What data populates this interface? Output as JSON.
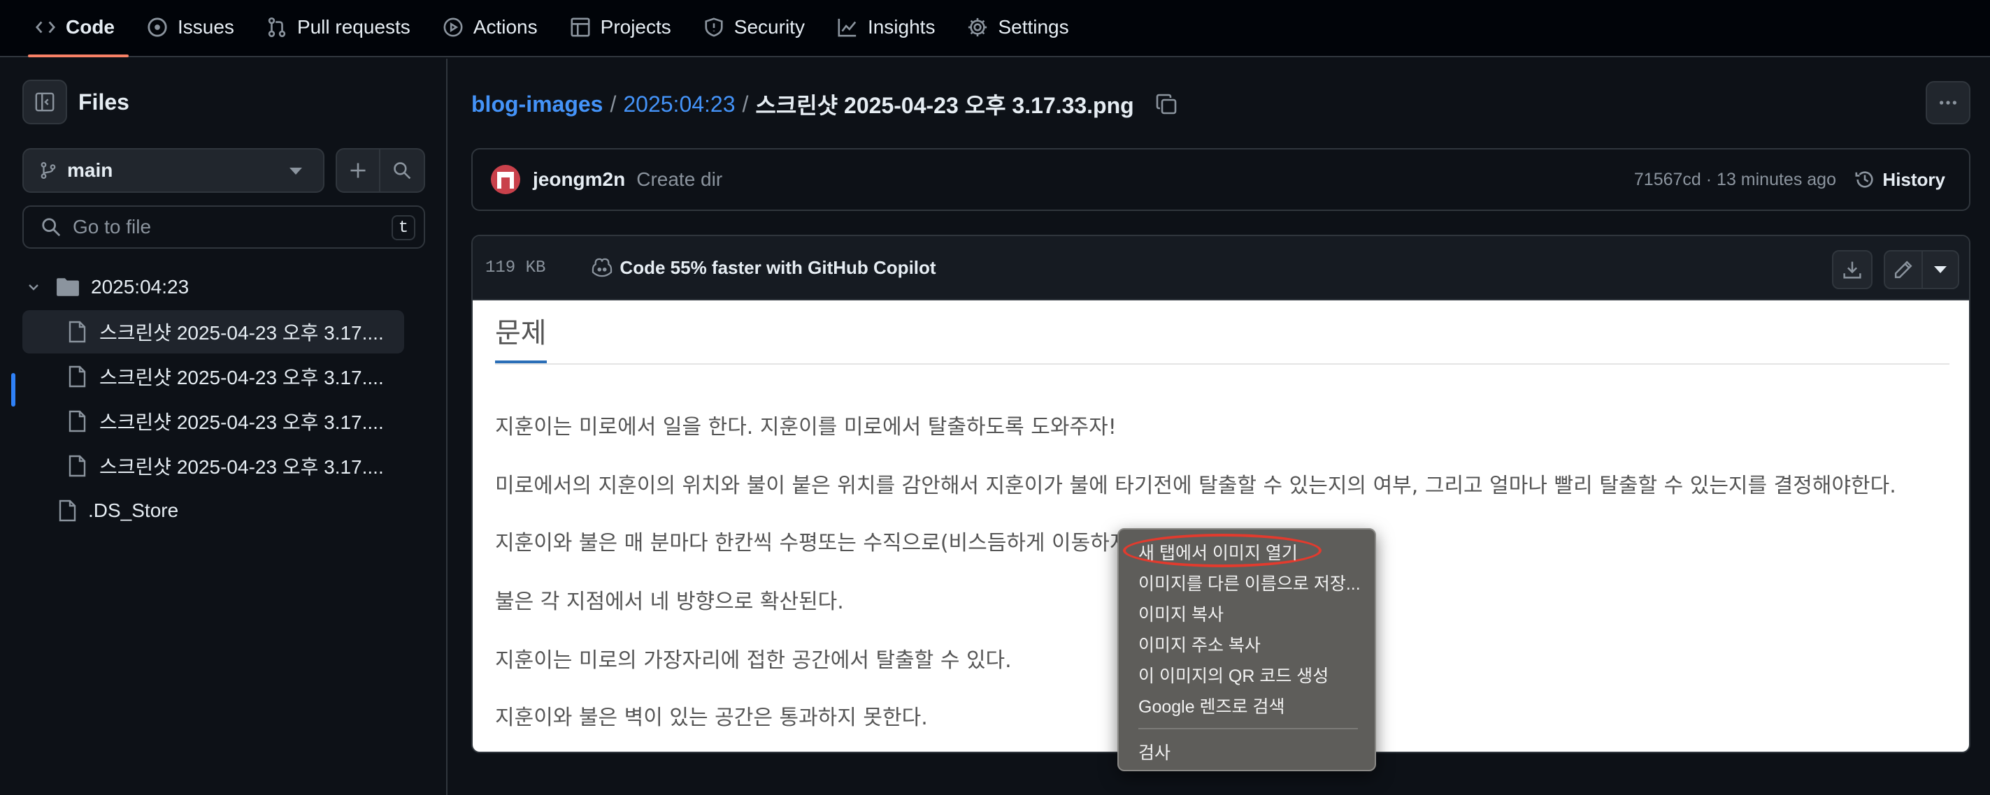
{
  "topnav": {
    "tabs": [
      {
        "label": "Code",
        "icon": "code-icon"
      },
      {
        "label": "Issues",
        "icon": "issue-icon"
      },
      {
        "label": "Pull requests",
        "icon": "pull-request-icon"
      },
      {
        "label": "Actions",
        "icon": "play-icon"
      },
      {
        "label": "Projects",
        "icon": "table-icon"
      },
      {
        "label": "Security",
        "icon": "shield-icon"
      },
      {
        "label": "Insights",
        "icon": "graph-icon"
      },
      {
        "label": "Settings",
        "icon": "gear-icon"
      }
    ],
    "active": "Code",
    "accent": "#f78166"
  },
  "sidebar": {
    "title": "Files",
    "branch": "main",
    "goto_placeholder": "Go to file",
    "goto_shortcut": "t",
    "tree": {
      "folder": "2025:04:23",
      "files": [
        "스크린샷 2025-04-23 오후 3.17....",
        "스크린샷 2025-04-23 오후 3.17....",
        "스크린샷 2025-04-23 오후 3.17....",
        "스크린샷 2025-04-23 오후 3.17...."
      ],
      "root_file": ".DS_Store"
    }
  },
  "breadcrumb": {
    "repo": "blog-images",
    "folder": "2025:04:23",
    "file": "스크린샷 2025-04-23 오후 3.17.33.png",
    "sep": "/"
  },
  "commit": {
    "author": "jeongm2n",
    "message": "Create dir",
    "meta": "71567cd · 13 minutes ago",
    "history": "History"
  },
  "file": {
    "size": "119 KB",
    "copilot": "Code 55% faster with GitHub Copilot"
  },
  "image": {
    "title": "문제",
    "paragraphs": [
      "지훈이는 미로에서 일을 한다. 지훈이를 미로에서 탈출하도록 도와주자!",
      "미로에서의 지훈이의 위치와 불이 붙은 위치를 감안해서 지훈이가 불에 타기전에 탈출할 수 있는지의 여부, 그리고 얼마나 빨리 탈출할 수 있는지를 결정해야한다.",
      "지훈이와 불은 매 분마다 한칸씩 수평또는 수직으로(비스듬하게 이동하지 않는다) 이동한다.",
      "불은 각 지점에서 네 방향으로 확산된다.",
      "지훈이는 미로의 가장자리에 접한 공간에서 탈출할 수 있다.",
      "지훈이와 불은 벽이 있는 공간은 통과하지 못한다."
    ]
  },
  "context_menu": {
    "items": [
      "새 탭에서 이미지 열기",
      "이미지를 다른 이름으로 저장...",
      "이미지 복사",
      "이미지 주소 복사",
      "이 이미지의 QR 코드 생성",
      "Google 렌즈로 검색"
    ],
    "inspect": "검사",
    "highlight_color": "#e23b2e"
  }
}
